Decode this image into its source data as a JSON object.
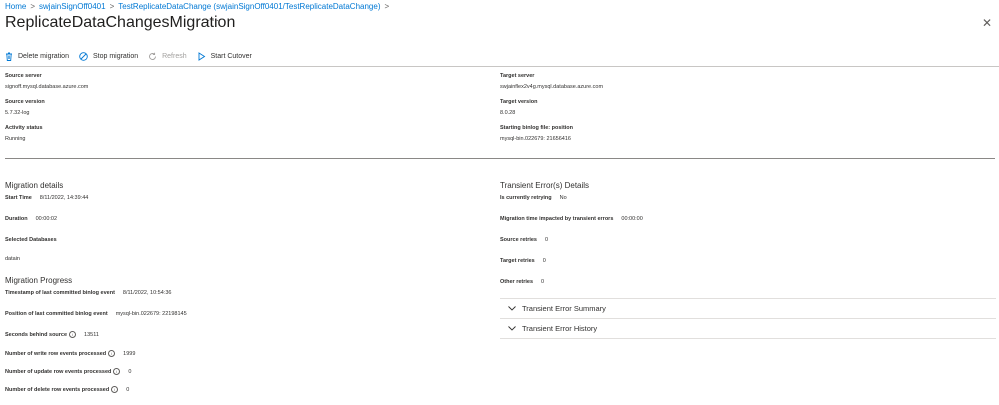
{
  "breadcrumb": {
    "items": [
      "Home",
      "swjainSignOff0401",
      "TestReplicateDataChange (swjainSignOff0401/TestReplicateDataChange)"
    ],
    "separator": ">"
  },
  "page": {
    "title": "ReplicateDataChangesMigration",
    "more": "···",
    "close": "✕"
  },
  "toolbar": {
    "delete": "Delete migration",
    "stop": "Stop migration",
    "refresh": "Refresh",
    "cutover": "Start Cutover"
  },
  "overview": {
    "source_server_label": "Source server",
    "source_server": "signoff.mysql.database.azure.com",
    "source_version_label": "Source version",
    "source_version": "5.7.32-log",
    "activity_status_label": "Activity status",
    "activity_status": "Running",
    "target_server_label": "Target server",
    "target_server": "swjainflex2v4g.mysql.database.azure.com",
    "target_version_label": "Target version",
    "target_version": "8.0.28",
    "binlog_label": "Starting binlog file: position",
    "binlog": "mysql-bin.022679: 21656416"
  },
  "details": {
    "heading": "Migration details",
    "start_time_label": "Start Time",
    "start_time": "8/11/2022, 14:39:44",
    "duration_label": "Duration",
    "duration": "00:00:02",
    "selected_db_label": "Selected Databases",
    "selected_db": "datain"
  },
  "progress": {
    "heading": "Migration Progress",
    "timestamp_label": "Timestamp of last committed binlog event",
    "timestamp": "8/11/2022, 10:54:36",
    "position_label": "Position of last committed binlog event",
    "position": "mysql-bin.022679: 22198145",
    "seconds_label": "Seconds behind source",
    "seconds": "13511",
    "write_label": "Number of write row events processed",
    "write": "1999",
    "update_label": "Number of update row events processed",
    "update": "0",
    "delete_label": "Number of delete row events processed",
    "delete": "0",
    "info_glyph": "i"
  },
  "transient": {
    "heading": "Transient Error(s) Details",
    "retrying_label": "Is currently retrying",
    "retrying": "No",
    "impacted_label": "Migration time impacted by transient errors",
    "impacted": "00:00:00",
    "source_retries_label": "Source retries",
    "source_retries": "0",
    "target_retries_label": "Target retries",
    "target_retries": "0",
    "other_retries_label": "Other retries",
    "other_retries": "0",
    "summary": "Transient Error Summary",
    "history": "Transient Error History"
  }
}
